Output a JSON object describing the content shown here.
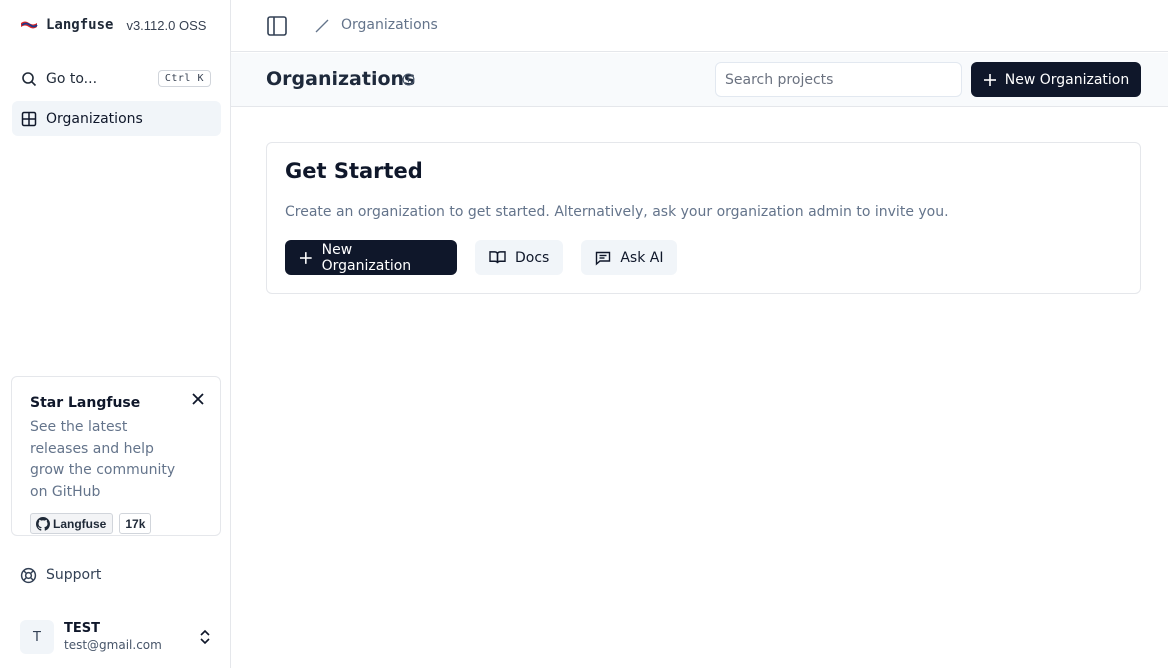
{
  "sidebar": {
    "brand": {
      "name": "Langfuse",
      "version": "v3.112.0 OSS"
    },
    "goto": {
      "label": "Go to...",
      "shortcut": "Ctrl K"
    },
    "nav": [
      {
        "label": "Organizations",
        "icon": "grid-icon",
        "active": true
      }
    ],
    "star_card": {
      "title": "Star Langfuse",
      "description": "See the latest releases and help grow the community on GitHub",
      "github_label": "Langfuse",
      "github_count": "17k"
    },
    "support": {
      "label": "Support"
    },
    "user": {
      "initial": "T",
      "name": "TEST",
      "email": "test@gmail.com"
    }
  },
  "topbar": {
    "breadcrumb": "Organizations"
  },
  "page_header": {
    "title": "Organizations",
    "search_placeholder": "Search projects",
    "new_button": "New Organization"
  },
  "card": {
    "title": "Get Started",
    "description": "Create an organization to get started. Alternatively, ask your organization admin to invite you.",
    "actions": {
      "primary": "New Organization",
      "docs": "Docs",
      "ask_ai": "Ask AI"
    }
  },
  "colors": {
    "primary": "#0f172a",
    "muted": "#64748b",
    "border": "#e5e7eb",
    "active_bg": "#f1f5f9"
  }
}
